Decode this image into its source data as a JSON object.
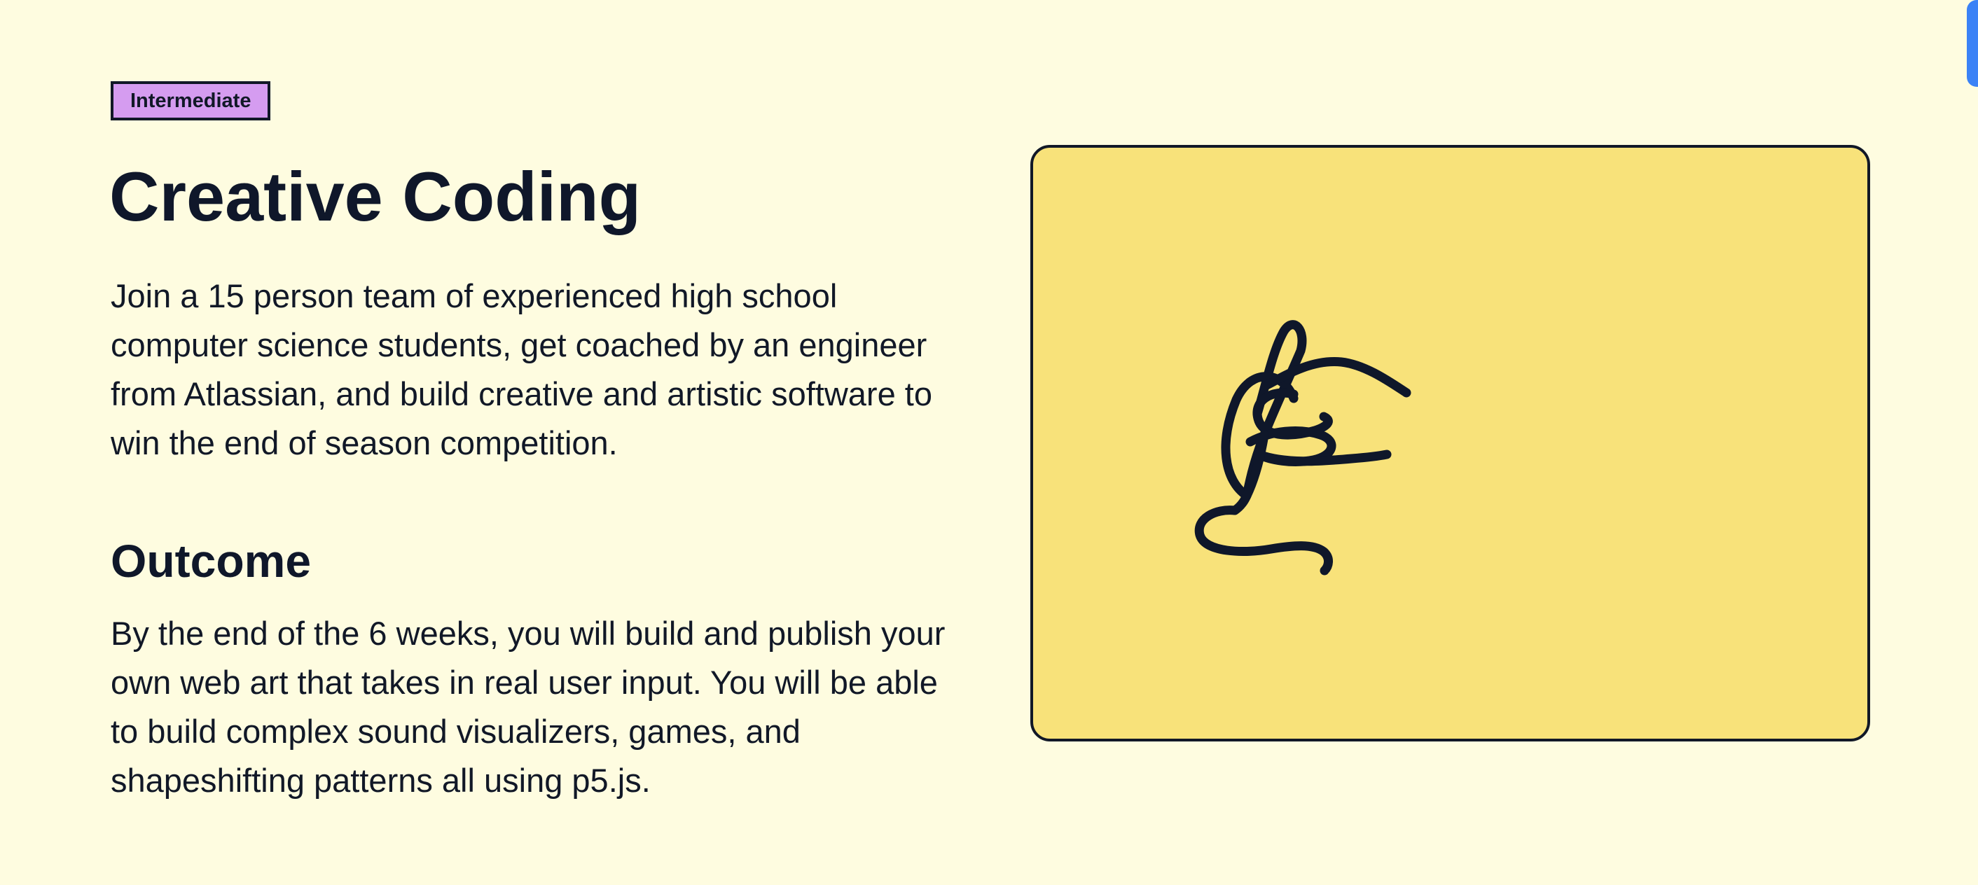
{
  "course": {
    "level_badge": "Intermediate",
    "title": "Creative Coding",
    "description": "Join a 15 person team of experienced high school computer science students, get coached by an engineer from Atlassian, and build creative and artistic software to win the end of season competition.",
    "outcome_heading": "Outcome",
    "outcome_text": "By the end of the 6 weeks, you will build and publish your own web art that takes in real user input. You will be able to build complex sound visualizers, games, and shapeshifting patterns all using p5.js."
  },
  "illustration": {
    "icon": "hand-drawing-scribble-icon"
  },
  "colors": {
    "page_background": "#fefce0",
    "badge_background": "#d59cf0",
    "card_background": "#f8e27a",
    "ink": "#0f172a",
    "edge_tab": "#3b82f6"
  }
}
